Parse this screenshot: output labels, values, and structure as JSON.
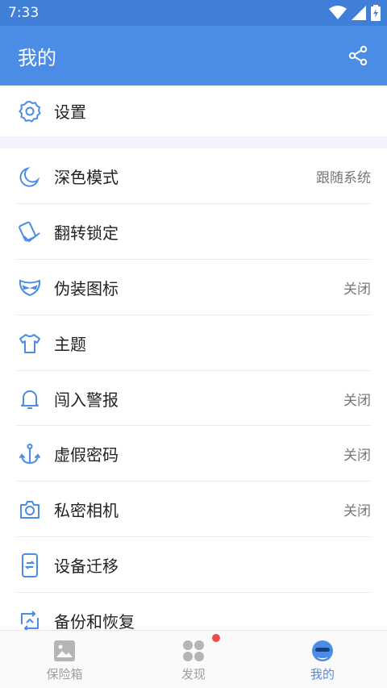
{
  "status_bar": {
    "time": "7:33"
  },
  "app_bar": {
    "title": "我的",
    "share_icon": "share-icon"
  },
  "settings": {
    "label": "设置",
    "icon": "gear-icon"
  },
  "menu": [
    {
      "label": "深色模式",
      "value": "跟随系统",
      "icon": "moon-icon"
    },
    {
      "label": "翻转锁定",
      "value": "",
      "icon": "flip-lock-icon"
    },
    {
      "label": "伪装图标",
      "value": "关闭",
      "icon": "mask-icon"
    },
    {
      "label": "主题",
      "value": "",
      "icon": "tshirt-icon"
    },
    {
      "label": "闯入警报",
      "value": "关闭",
      "icon": "bell-icon"
    },
    {
      "label": "虚假密码",
      "value": "关闭",
      "icon": "anchor-icon"
    },
    {
      "label": "私密相机",
      "value": "关闭",
      "icon": "camera-icon"
    },
    {
      "label": "设备迁移",
      "value": "",
      "icon": "phone-transfer-icon"
    },
    {
      "label": "备份和恢复",
      "value": "",
      "icon": "backup-icon"
    }
  ],
  "bottom_nav": [
    {
      "label": "保险箱",
      "icon": "image-icon",
      "active": false
    },
    {
      "label": "发现",
      "icon": "grid-icon",
      "active": false,
      "badge": true
    },
    {
      "label": "我的",
      "icon": "avatar-icon",
      "active": true
    }
  ],
  "colors": {
    "primary": "#4a8ce6",
    "status_bar": "#3f7fd8",
    "badge": "#ef4b4b",
    "inactive": "#9e9e9e"
  }
}
